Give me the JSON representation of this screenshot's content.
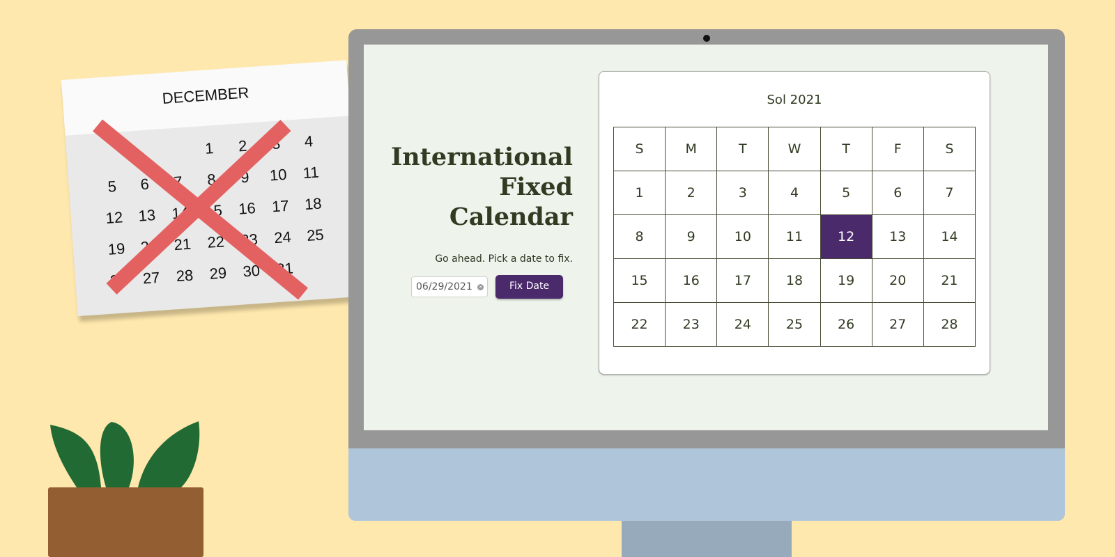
{
  "paper_calendar": {
    "month": "DECEMBER",
    "rows": [
      [
        "",
        "",
        "",
        "1",
        "2",
        "3",
        "4"
      ],
      [
        "5",
        "6",
        "7",
        "8",
        "9",
        "10",
        "11"
      ],
      [
        "12",
        "13",
        "14",
        "15",
        "16",
        "17",
        "18"
      ],
      [
        "19",
        "20",
        "21",
        "22",
        "23",
        "24",
        "25"
      ],
      [
        "26",
        "27",
        "28",
        "29",
        "30",
        "31",
        ""
      ]
    ]
  },
  "app": {
    "title_lines": [
      "International",
      "Fixed",
      "Calendar"
    ],
    "prompt": "Go ahead. Pick a date to fix.",
    "date_input": {
      "month": "06",
      "day": "29",
      "year": "2021",
      "separator": "/"
    },
    "fix_button": "Fix Date"
  },
  "calendar": {
    "title": "Sol 2021",
    "weekdays": [
      "S",
      "M",
      "T",
      "W",
      "T",
      "F",
      "S"
    ],
    "weeks": [
      [
        "1",
        "2",
        "3",
        "4",
        "5",
        "6",
        "7"
      ],
      [
        "8",
        "9",
        "10",
        "11",
        "12",
        "13",
        "14"
      ],
      [
        "15",
        "16",
        "17",
        "18",
        "19",
        "20",
        "21"
      ],
      [
        "22",
        "23",
        "24",
        "25",
        "26",
        "27",
        "28"
      ]
    ],
    "selected_day": "12"
  },
  "colors": {
    "background": "#ffe8ad",
    "accent": "#4a2a6b",
    "text_dark": "#313b22",
    "cross": "#e46161",
    "monitor_chin": "#afc5da"
  }
}
